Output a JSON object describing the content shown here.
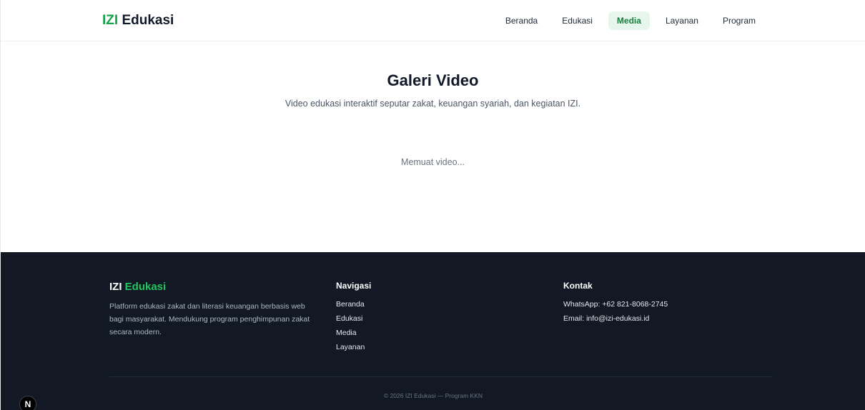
{
  "header": {
    "logo_prefix": "IZI",
    "logo_suffix": "Edukasi",
    "nav": [
      {
        "label": "Beranda"
      },
      {
        "label": "Edukasi"
      },
      {
        "label": "Media"
      },
      {
        "label": "Layanan"
      },
      {
        "label": "Program"
      }
    ],
    "active_nav": "Media"
  },
  "main": {
    "title": "Galeri Video",
    "subtitle": "Video edukasi interaktif seputar zakat, keuangan syariah, dan kegiatan IZI.",
    "loading_text": "Memuat video..."
  },
  "footer": {
    "brand_prefix": "IZI",
    "brand_suffix": "Edukasi",
    "description": "Platform edukasi zakat dan literasi keuangan berbasis web bagi masyarakat. Mendukung program penghimpunan zakat secara modern.",
    "nav_heading": "Navigasi",
    "nav_links": [
      {
        "label": "Beranda"
      },
      {
        "label": "Edukasi"
      },
      {
        "label": "Media"
      },
      {
        "label": "Layanan"
      }
    ],
    "contact_heading": "Kontak",
    "whatsapp": "WhatsApp: +62 821-8068-2745",
    "email": "Email: info@izi-edukasi.id",
    "copyright": "© 2026 IZI Edukasi — Program KKN"
  },
  "dev_badge": {
    "label": "N"
  },
  "colors": {
    "accent": "#16a34a",
    "nav_active_bg": "#e7f6ec",
    "footer_bg": "#121924"
  }
}
